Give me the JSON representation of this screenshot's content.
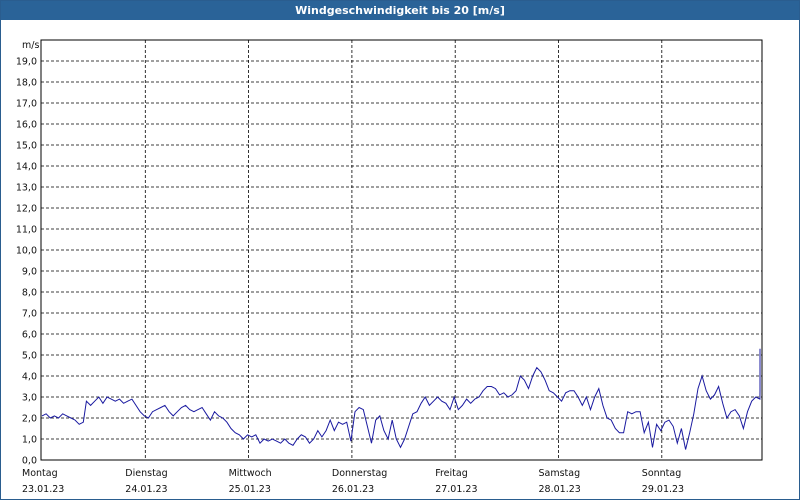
{
  "window": {
    "title": "Windgeschwindigkeit bis 20 [m/s]"
  },
  "chart_data": {
    "type": "line",
    "title": "Windgeschwindigkeit bis 20 [m/s]",
    "ylabel": "m/s",
    "ylim": [
      0,
      20
    ],
    "yticks": [
      "0,0",
      "1,0",
      "2,0",
      "3,0",
      "4,0",
      "5,0",
      "6,0",
      "7,0",
      "8,0",
      "9,0",
      "10,0",
      "11,0",
      "12,0",
      "13,0",
      "14,0",
      "15,0",
      "16,0",
      "17,0",
      "18,0",
      "19,0"
    ],
    "xticks": [
      {
        "day": "Montag",
        "date": "23.01.23"
      },
      {
        "day": "Dienstag",
        "date": "24.01.23"
      },
      {
        "day": "Mittwoch",
        "date": "25.01.23"
      },
      {
        "day": "Donnerstag",
        "date": "26.01.23"
      },
      {
        "day": "Freitag",
        "date": "27.01.23"
      },
      {
        "day": "Samstag",
        "date": "28.01.23"
      },
      {
        "day": "Sonntag",
        "date": "29.01.23"
      }
    ],
    "xlim_days": [
      0,
      7
    ],
    "grid": true,
    "series": [
      {
        "color": "#1a1aa0",
        "points": [
          [
            0.0,
            2.1
          ],
          [
            0.04,
            2.2
          ],
          [
            0.08,
            2.0
          ],
          [
            0.12,
            2.1
          ],
          [
            0.16,
            2.0
          ],
          [
            0.2,
            2.2
          ],
          [
            0.24,
            2.1
          ],
          [
            0.28,
            2.0
          ],
          [
            0.32,
            1.9
          ],
          [
            0.36,
            1.7
          ],
          [
            0.4,
            1.8
          ],
          [
            0.43,
            2.8
          ],
          [
            0.47,
            2.6
          ],
          [
            0.51,
            2.8
          ],
          [
            0.55,
            3.0
          ],
          [
            0.59,
            2.7
          ],
          [
            0.63,
            3.0
          ],
          [
            0.67,
            2.9
          ],
          [
            0.71,
            2.8
          ],
          [
            0.75,
            2.9
          ],
          [
            0.79,
            2.7
          ],
          [
            0.83,
            2.8
          ],
          [
            0.87,
            2.9
          ],
          [
            0.91,
            2.6
          ],
          [
            0.95,
            2.3
          ],
          [
            0.99,
            2.1
          ],
          [
            1.03,
            2.0
          ],
          [
            1.07,
            2.3
          ],
          [
            1.11,
            2.4
          ],
          [
            1.15,
            2.5
          ],
          [
            1.19,
            2.6
          ],
          [
            1.23,
            2.3
          ],
          [
            1.27,
            2.1
          ],
          [
            1.31,
            2.3
          ],
          [
            1.35,
            2.5
          ],
          [
            1.39,
            2.6
          ],
          [
            1.43,
            2.4
          ],
          [
            1.47,
            2.3
          ],
          [
            1.51,
            2.4
          ],
          [
            1.55,
            2.5
          ],
          [
            1.59,
            2.2
          ],
          [
            1.63,
            1.9
          ],
          [
            1.67,
            2.3
          ],
          [
            1.71,
            2.1
          ],
          [
            1.75,
            2.0
          ],
          [
            1.79,
            1.8
          ],
          [
            1.83,
            1.5
          ],
          [
            1.87,
            1.3
          ],
          [
            1.91,
            1.2
          ],
          [
            1.95,
            1.0
          ],
          [
            1.99,
            1.2
          ],
          [
            2.03,
            1.1
          ],
          [
            2.07,
            1.2
          ],
          [
            2.11,
            0.8
          ],
          [
            2.15,
            1.0
          ],
          [
            2.19,
            0.9
          ],
          [
            2.23,
            1.0
          ],
          [
            2.27,
            0.9
          ],
          [
            2.31,
            0.8
          ],
          [
            2.35,
            1.0
          ],
          [
            2.39,
            0.8
          ],
          [
            2.43,
            0.7
          ],
          [
            2.47,
            1.0
          ],
          [
            2.51,
            1.2
          ],
          [
            2.55,
            1.1
          ],
          [
            2.59,
            0.8
          ],
          [
            2.63,
            1.0
          ],
          [
            2.67,
            1.4
          ],
          [
            2.71,
            1.1
          ],
          [
            2.75,
            1.4
          ],
          [
            2.79,
            1.9
          ],
          [
            2.83,
            1.4
          ],
          [
            2.87,
            1.8
          ],
          [
            2.91,
            1.7
          ],
          [
            2.95,
            1.8
          ],
          [
            2.99,
            0.9
          ],
          [
            3.03,
            2.3
          ],
          [
            3.07,
            2.5
          ],
          [
            3.11,
            2.4
          ],
          [
            3.15,
            1.6
          ],
          [
            3.19,
            0.8
          ],
          [
            3.23,
            1.9
          ],
          [
            3.27,
            2.1
          ],
          [
            3.31,
            1.4
          ],
          [
            3.35,
            1.0
          ],
          [
            3.39,
            1.9
          ],
          [
            3.43,
            1.0
          ],
          [
            3.47,
            0.6
          ],
          [
            3.51,
            1.0
          ],
          [
            3.55,
            1.6
          ],
          [
            3.59,
            2.2
          ],
          [
            3.63,
            2.3
          ],
          [
            3.67,
            2.7
          ],
          [
            3.71,
            3.0
          ],
          [
            3.75,
            2.6
          ],
          [
            3.79,
            2.8
          ],
          [
            3.83,
            3.0
          ],
          [
            3.87,
            2.8
          ],
          [
            3.91,
            2.7
          ],
          [
            3.95,
            2.4
          ],
          [
            3.99,
            3.0
          ],
          [
            4.03,
            2.4
          ],
          [
            4.07,
            2.6
          ],
          [
            4.11,
            2.9
          ],
          [
            4.15,
            2.7
          ],
          [
            4.19,
            2.9
          ],
          [
            4.23,
            3.0
          ],
          [
            4.27,
            3.3
          ],
          [
            4.31,
            3.5
          ],
          [
            4.35,
            3.5
          ],
          [
            4.39,
            3.4
          ],
          [
            4.43,
            3.1
          ],
          [
            4.47,
            3.2
          ],
          [
            4.51,
            3.0
          ],
          [
            4.55,
            3.1
          ],
          [
            4.59,
            3.3
          ],
          [
            4.63,
            4.0
          ],
          [
            4.67,
            3.8
          ],
          [
            4.71,
            3.4
          ],
          [
            4.75,
            4.0
          ],
          [
            4.79,
            4.4
          ],
          [
            4.83,
            4.2
          ],
          [
            4.87,
            3.8
          ],
          [
            4.91,
            3.3
          ],
          [
            4.95,
            3.2
          ],
          [
            4.99,
            3.0
          ],
          [
            5.03,
            2.8
          ],
          [
            5.07,
            3.2
          ],
          [
            5.11,
            3.3
          ],
          [
            5.15,
            3.3
          ],
          [
            5.19,
            3.0
          ],
          [
            5.23,
            2.6
          ],
          [
            5.27,
            3.0
          ],
          [
            5.31,
            2.4
          ],
          [
            5.35,
            3.0
          ],
          [
            5.39,
            3.4
          ],
          [
            5.43,
            2.6
          ],
          [
            5.47,
            2.0
          ],
          [
            5.51,
            1.9
          ],
          [
            5.55,
            1.5
          ],
          [
            5.59,
            1.3
          ],
          [
            5.63,
            1.3
          ],
          [
            5.67,
            2.3
          ],
          [
            5.71,
            2.2
          ],
          [
            5.75,
            2.3
          ],
          [
            5.79,
            2.3
          ],
          [
            5.83,
            1.3
          ],
          [
            5.87,
            1.8
          ],
          [
            5.91,
            0.6
          ],
          [
            5.95,
            1.7
          ],
          [
            5.99,
            1.4
          ],
          [
            6.03,
            1.8
          ],
          [
            6.07,
            1.9
          ],
          [
            6.11,
            1.6
          ],
          [
            6.15,
            0.8
          ],
          [
            6.19,
            1.5
          ],
          [
            6.23,
            0.5
          ],
          [
            6.27,
            1.3
          ],
          [
            6.31,
            2.2
          ],
          [
            6.35,
            3.4
          ],
          [
            6.39,
            4.0
          ],
          [
            6.43,
            3.3
          ],
          [
            6.47,
            2.9
          ],
          [
            6.51,
            3.1
          ],
          [
            6.55,
            3.5
          ],
          [
            6.59,
            2.7
          ],
          [
            6.63,
            2.0
          ],
          [
            6.67,
            2.3
          ],
          [
            6.71,
            2.4
          ],
          [
            6.75,
            2.1
          ],
          [
            6.79,
            1.5
          ],
          [
            6.83,
            2.3
          ],
          [
            6.87,
            2.8
          ],
          [
            6.91,
            3.0
          ],
          [
            6.95,
            2.9
          ],
          [
            6.99,
            3.3
          ],
          [
            7.03,
            3.8
          ],
          [
            7.07,
            4.0
          ],
          [
            7.11,
            5.3
          ],
          [
            7.15,
            5.0
          ],
          [
            7.19,
            4.0
          ],
          [
            7.23,
            5.0
          ],
          [
            7.27,
            4.3
          ]
        ]
      }
    ]
  }
}
